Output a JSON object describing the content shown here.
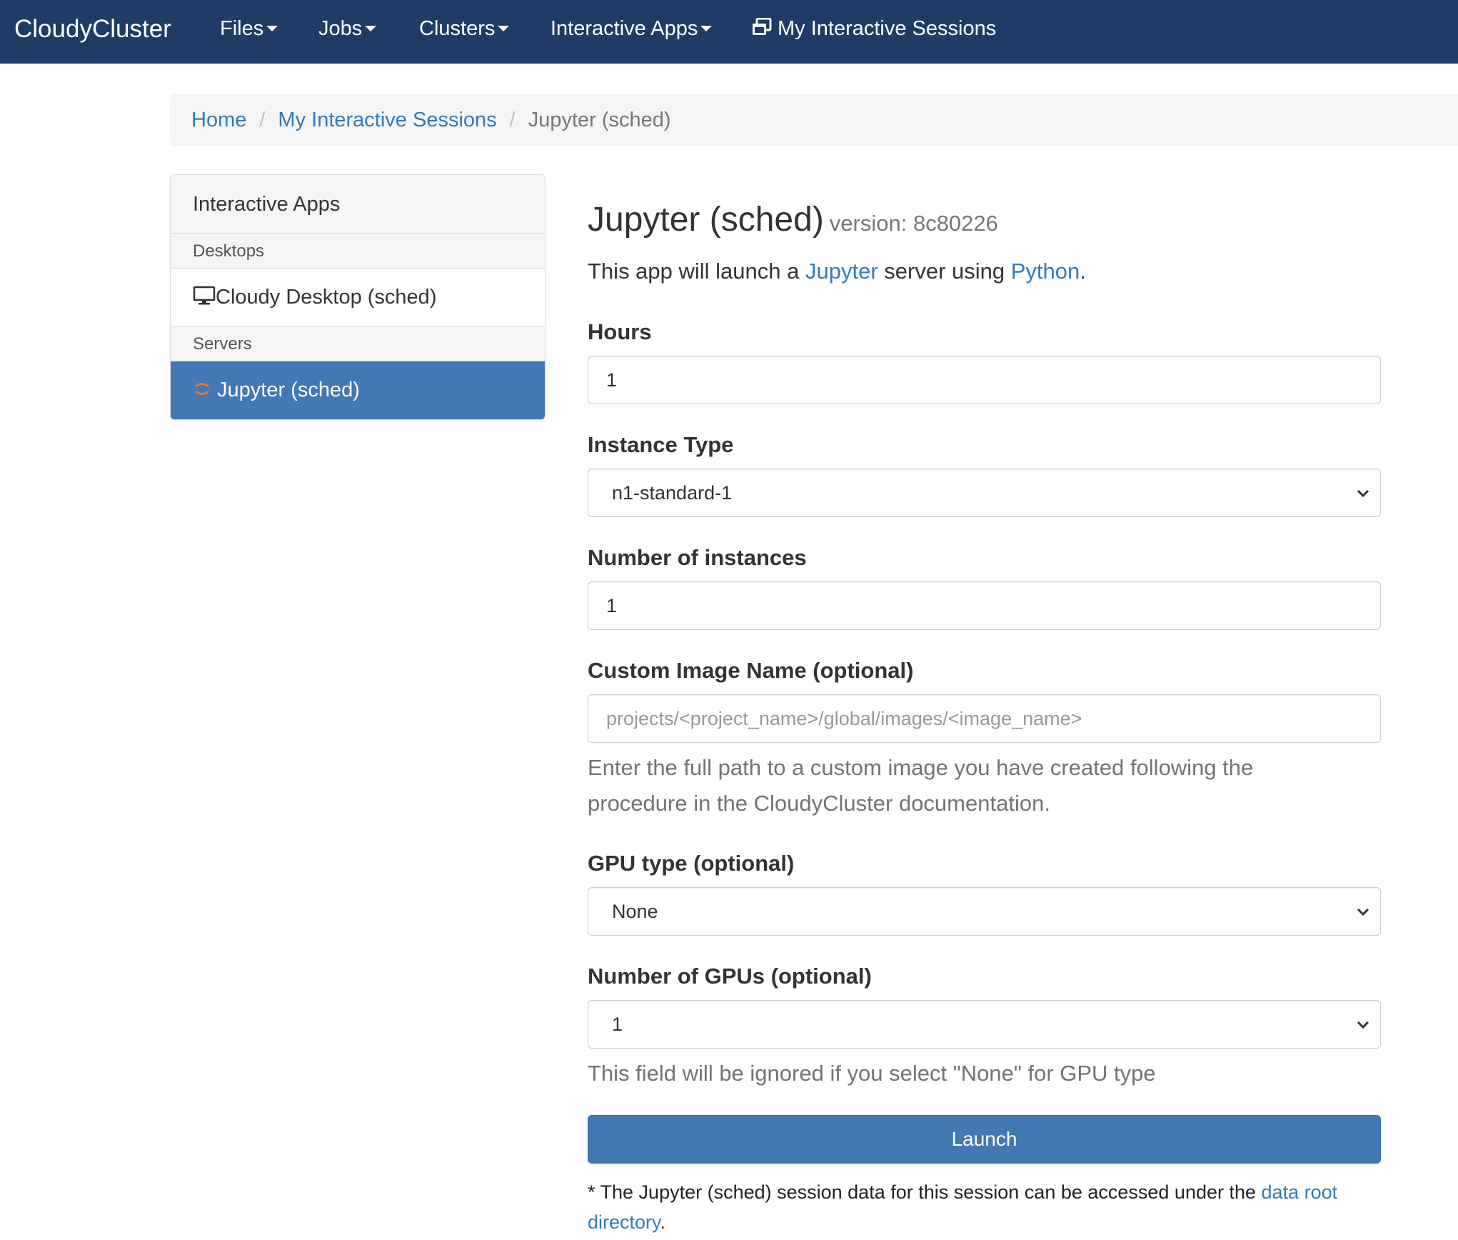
{
  "navbar": {
    "brand": "CloudyCluster",
    "items": [
      {
        "label": "Files"
      },
      {
        "label": "Jobs"
      },
      {
        "label": "Clusters"
      },
      {
        "label": "Interactive Apps"
      },
      {
        "label": "My Interactive Sessions"
      }
    ]
  },
  "breadcrumb": {
    "home": "Home",
    "sessions": "My Interactive Sessions",
    "current": "Jupyter (sched)",
    "separator": "/"
  },
  "sidebar": {
    "header": "Interactive Apps",
    "sections": [
      {
        "title": "Desktops",
        "items": [
          {
            "label": "Cloudy Desktop (sched)",
            "icon": "monitor-icon"
          }
        ]
      },
      {
        "title": "Servers",
        "items": [
          {
            "label": "Jupyter (sched)",
            "icon": "jupyter-icon",
            "active": true
          }
        ]
      }
    ]
  },
  "app": {
    "title": "Jupyter (sched)",
    "version": "version: 8c80226",
    "desc_prefix": "This app will launch a ",
    "desc_link1": "Jupyter",
    "desc_mid": " server using ",
    "desc_link2": "Python",
    "desc_suffix": "."
  },
  "form": {
    "hours": {
      "label": "Hours",
      "value": "1"
    },
    "instance_type": {
      "label": "Instance Type",
      "value": "n1-standard-1"
    },
    "num_instances": {
      "label": "Number of instances",
      "value": "1"
    },
    "custom_image": {
      "label": "Custom Image Name (optional)",
      "placeholder": "projects/<project_name>/global/images/<image_name>",
      "help_line1": "Enter the full path to a custom image you have created following the",
      "help_line2": "procedure in the CloudyCluster documentation."
    },
    "gpu_type": {
      "label": "GPU type (optional)",
      "value": "None"
    },
    "num_gpus": {
      "label": "Number of GPUs (optional)",
      "value": "1",
      "help": "This field will be ignored if you select \"None\" for GPU type"
    },
    "launch_label": "Launch",
    "footnote_prefix": "* The Jupyter (sched) session data for this session can be accessed under the ",
    "footnote_link1": "data root",
    "footnote_link2": "directory",
    "footnote_suffix": "."
  },
  "colors": {
    "navbar": "#1e3c66",
    "primary": "#4278b3",
    "link": "#337ab7"
  }
}
